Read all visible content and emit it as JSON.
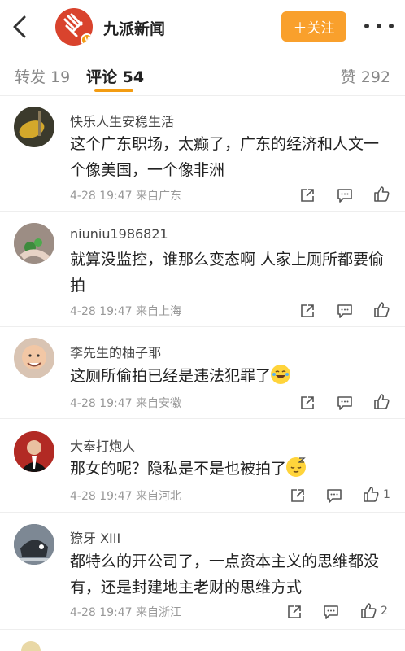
{
  "header": {
    "account_name": "九派新闻",
    "follow_label": "＋关注"
  },
  "tabs": {
    "repost": "转发 19",
    "comment": "评论 54",
    "like": "赞 292"
  },
  "comments": [
    {
      "user": "快乐人生安稳生活",
      "text": "这个广东职场，太癫了，广东的经济和人文一个像美国，一个像非洲",
      "meta": "4-28 19:47  来自广东",
      "likes": ""
    },
    {
      "user": "niuniu1986821",
      "text": "就算没监控，谁那么变态啊 人家上厕所都要偷拍",
      "meta": "4-28 19:47  来自上海",
      "likes": ""
    },
    {
      "user": "李先生的柚子耶",
      "text": "这厕所偷拍已经是违法犯罪了",
      "meta": "4-28 19:47  来自安徽",
      "likes": "",
      "emoji": "laugh-cry-emoji"
    },
    {
      "user": "大奉打炮人",
      "text": "那女的呢？隐私是不是也被拍了",
      "meta": "4-28 19:47  来自河北",
      "likes": "1",
      "emoji": "sleepy-emoji"
    },
    {
      "user": "獠牙 XIII",
      "text": "都特么的开公司了，一点资本主义的思维都没有，还是封建地主老财的思维方式",
      "meta": "4-28 19:47  来自浙江",
      "likes": "2"
    }
  ],
  "colors": {
    "accent": "#f9a02c",
    "tab_underline": "#f39c12",
    "logo": "#d9432d"
  }
}
